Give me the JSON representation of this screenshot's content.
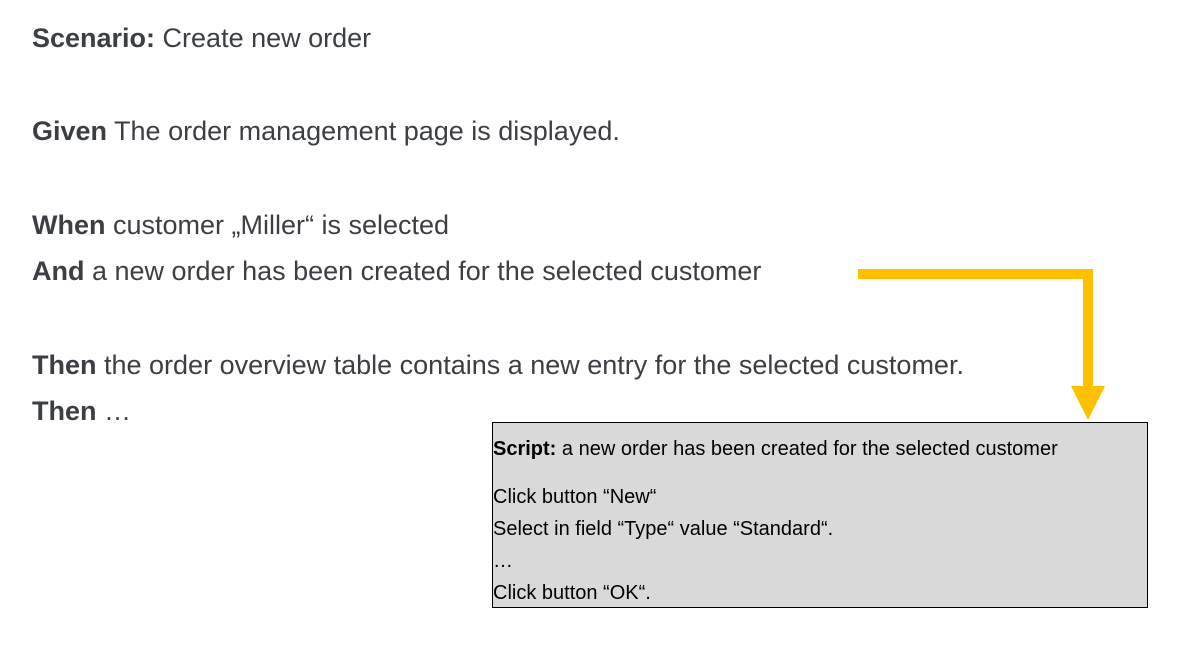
{
  "scenario": {
    "keyword": "Scenario:",
    "text": " Create new order"
  },
  "steps": [
    {
      "keyword": "Given",
      "text": " The order management page is displayed."
    },
    {
      "keyword": "When",
      "text": " customer „Miller“ is selected"
    },
    {
      "keyword": "And",
      "text": " a new order has been created for the selected customer"
    },
    {
      "keyword": "Then",
      "text": " the order overview table contains a new entry for the selected customer."
    },
    {
      "keyword": "Then",
      "text": " …"
    }
  ],
  "script": {
    "keyword": "Script:",
    "title": " a new order has been created for the selected customer",
    "lines": [
      "Click button “New“",
      "Select in field “Type“ value “Standard“.",
      "…",
      "Click button “OK“."
    ]
  },
  "colors": {
    "arrow": "#FFC000",
    "text": "#3B3F44",
    "script_bg": "#D9D9D9"
  }
}
